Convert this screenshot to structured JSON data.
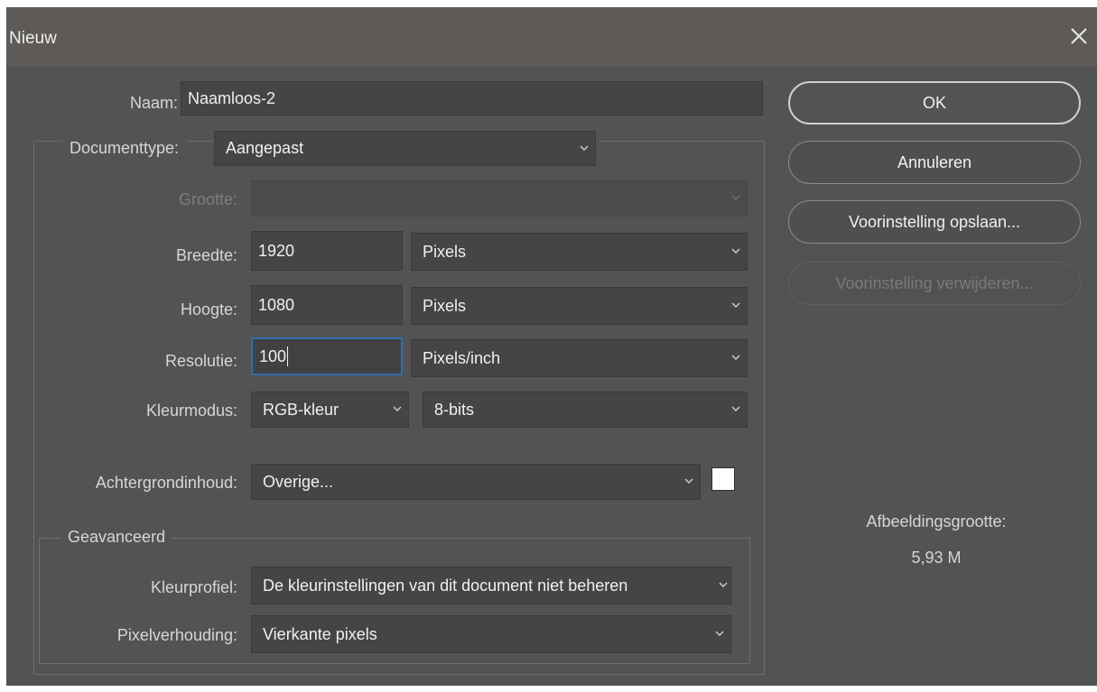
{
  "window": {
    "title": "Nieuw",
    "close_icon": "close-icon"
  },
  "form": {
    "name_label": "Naam:",
    "name_value": "Naamloos-2",
    "doctype_label": "Documenttype:",
    "doctype_value": "Aangepast",
    "size_label": "Grootte:",
    "size_value": "",
    "width_label": "Breedte:",
    "width_value": "1920",
    "width_unit": "Pixels",
    "height_label": "Hoogte:",
    "height_value": "1080",
    "height_unit": "Pixels",
    "resolution_label": "Resolutie:",
    "resolution_value": "100",
    "resolution_unit": "Pixels/inch",
    "colormode_label": "Kleurmodus:",
    "colormode_value": "RGB-kleur",
    "bitdepth_value": "8-bits",
    "background_label": "Achtergrondinhoud:",
    "background_value": "Overige...",
    "background_color": "#ffffff"
  },
  "advanced": {
    "title": "Geavanceerd",
    "profile_label": "Kleurprofiel:",
    "profile_value": "De kleurinstellingen van dit document niet beheren",
    "pixel_label": "Pixelverhouding:",
    "pixel_value": "Vierkante pixels"
  },
  "buttons": {
    "ok": "OK",
    "cancel": "Annuleren",
    "save_preset": "Voorinstelling opslaan...",
    "delete_preset": "Voorinstelling verwijderen..."
  },
  "image_size": {
    "label": "Afbeeldingsgrootte:",
    "value": "5,93 M"
  },
  "colors": {
    "dialog_bg": "#535353",
    "titlebar_bg": "#5d5a57",
    "focus_border": "#2f6fae"
  }
}
